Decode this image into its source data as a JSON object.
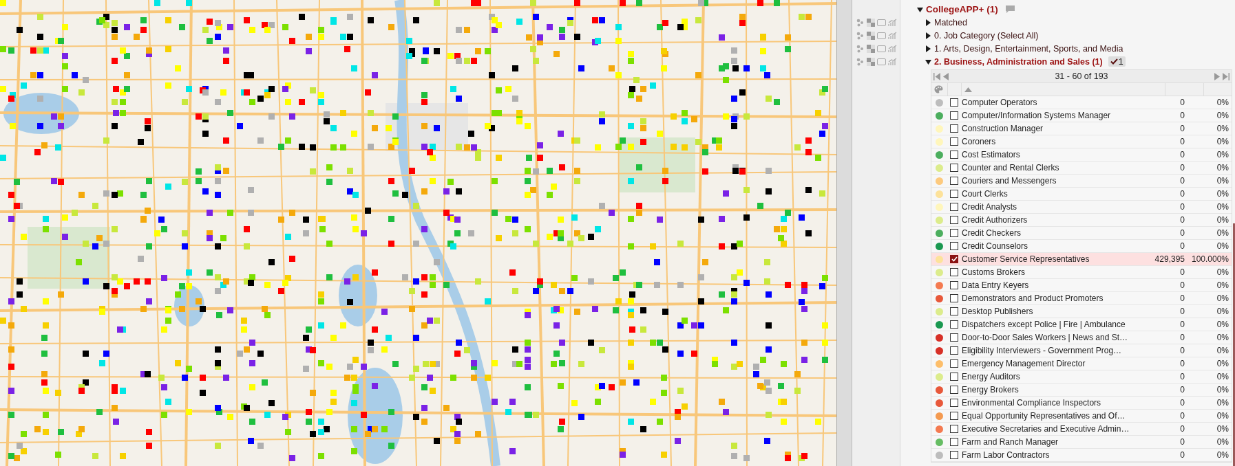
{
  "panel": {
    "title": "CollegeAPP+ (1)",
    "highlighted": true,
    "expanded": true,
    "categories": [
      {
        "label": "Matched",
        "expanded": false,
        "highlighted": false
      },
      {
        "label": "0. Job Category (Select All)",
        "expanded": false,
        "highlighted": false
      },
      {
        "label": "1. Arts, Design, Entertainment, Sports, and Media",
        "expanded": false,
        "highlighted": false
      },
      {
        "label": "2. Business, Administration and Sales (1)",
        "expanded": true,
        "highlighted": true,
        "checked_count": "1"
      }
    ],
    "table": {
      "pager": "31 - 60 of 193",
      "rows": [
        {
          "name": "Computer Operators",
          "count": "0",
          "percent": "0%",
          "color": "#bdbdbd",
          "checked": false
        },
        {
          "name": "Computer/Information Systems Manager",
          "count": "0",
          "percent": "0%",
          "color": "#4cae5e",
          "checked": false
        },
        {
          "name": "Construction Manager",
          "count": "0",
          "percent": "0%",
          "color": "#fff6bb",
          "checked": false
        },
        {
          "name": "Coroners",
          "count": "0",
          "percent": "0%",
          "color": "#fff6bb",
          "checked": false
        },
        {
          "name": "Cost Estimators",
          "count": "0",
          "percent": "0%",
          "color": "#4cae5e",
          "checked": false
        },
        {
          "name": "Counter and Rental Clerks",
          "count": "0",
          "percent": "0%",
          "color": "#dcec8c",
          "checked": false
        },
        {
          "name": "Couriers and Messengers",
          "count": "0",
          "percent": "0%",
          "color": "#fdca7e",
          "checked": false
        },
        {
          "name": "Court Clerks",
          "count": "0",
          "percent": "0%",
          "color": "#fde29a",
          "checked": false
        },
        {
          "name": "Credit Analysts",
          "count": "0",
          "percent": "0%",
          "color": "#fff6bb",
          "checked": false
        },
        {
          "name": "Credit Authorizers",
          "count": "0",
          "percent": "0%",
          "color": "#dcec8c",
          "checked": false
        },
        {
          "name": "Credit Checkers",
          "count": "0",
          "percent": "0%",
          "color": "#4cae5e",
          "checked": false
        },
        {
          "name": "Credit Counselors",
          "count": "0",
          "percent": "0%",
          "color": "#1a9850",
          "checked": false
        },
        {
          "name": "Customer Service Representatives",
          "count": "429,395",
          "percent": "100.000%",
          "color": "#fde29a",
          "checked": true
        },
        {
          "name": "Customs Brokers",
          "count": "0",
          "percent": "0%",
          "color": "#dcec8c",
          "checked": false
        },
        {
          "name": "Data Entry Keyers",
          "count": "0",
          "percent": "0%",
          "color": "#f47a50",
          "checked": false
        },
        {
          "name": "Demonstrators and Product Promoters",
          "count": "0",
          "percent": "0%",
          "color": "#e8583a",
          "checked": false
        },
        {
          "name": "Desktop Publishers",
          "count": "0",
          "percent": "0%",
          "color": "#dcec8c",
          "checked": false
        },
        {
          "name": "Dispatchers except Police | Fire | Ambulance",
          "count": "0",
          "percent": "0%",
          "color": "#1a9850",
          "checked": false
        },
        {
          "name": "Door-to-Door Sales Workers | News and St…",
          "count": "0",
          "percent": "0%",
          "color": "#d73027",
          "checked": false
        },
        {
          "name": "Eligibility Interviewers - Government Prog…",
          "count": "0",
          "percent": "0%",
          "color": "#d73027",
          "checked": false
        },
        {
          "name": "Emergency Management Director",
          "count": "0",
          "percent": "0%",
          "color": "#fdbe6a",
          "checked": false
        },
        {
          "name": "Energy Auditors",
          "count": "0",
          "percent": "0%",
          "color": "#dcec8c",
          "checked": false
        },
        {
          "name": "Energy Brokers",
          "count": "0",
          "percent": "0%",
          "color": "#e8583a",
          "checked": false
        },
        {
          "name": "Environmental Compliance Inspectors",
          "count": "0",
          "percent": "0%",
          "color": "#e8583a",
          "checked": false
        },
        {
          "name": "Equal Opportunity Representatives and Of…",
          "count": "0",
          "percent": "0%",
          "color": "#f49a50",
          "checked": false
        },
        {
          "name": "Executive Secretaries and Executive Admin…",
          "count": "0",
          "percent": "0%",
          "color": "#f47a50",
          "checked": false
        },
        {
          "name": "Farm and Ranch Manager",
          "count": "0",
          "percent": "0%",
          "color": "#66bd63",
          "checked": false
        },
        {
          "name": "Farm Labor Contractors",
          "count": "0",
          "percent": "0%",
          "color": "#bdbdbd",
          "checked": false
        }
      ]
    }
  }
}
